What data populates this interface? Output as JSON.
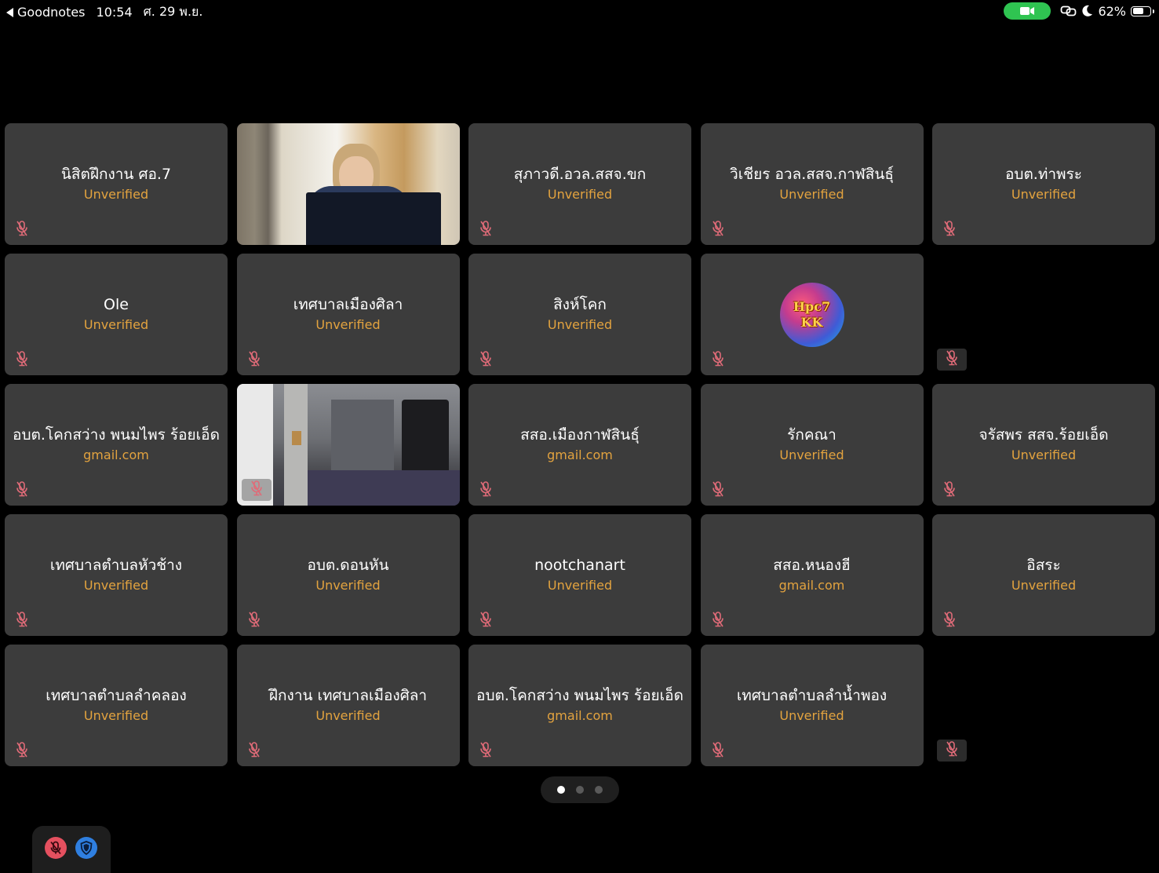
{
  "status_bar": {
    "back_app": "Goodnotes",
    "time": "10:54",
    "date": "ศ. 29 พ.ย.",
    "battery": "62%",
    "battery_level": 0.62
  },
  "tiles": [
    {
      "name": "นิสิตฝึกงาน ศอ.7",
      "sub": "Unverified"
    },
    {
      "video": true
    },
    {
      "name": "สุภาวดี.อวล.สสจ.ขก",
      "sub": "Unverified"
    },
    {
      "name": "วิเชียร อวล.สสจ.กาฬสินธุ์",
      "sub": "Unverified"
    },
    {
      "name": "อบต.ท่าพระ",
      "sub": "Unverified"
    },
    {
      "name": "Ole",
      "sub": "Unverified"
    },
    {
      "name": "เทศบาลเมืองศิลา",
      "sub": "Unverified"
    },
    {
      "name": "สิงห์โคก",
      "sub": "Unverified"
    },
    {
      "avatar": true
    },
    {
      "empty": true
    },
    {
      "name": "อบต.โคกสว่าง พนมไพร ร้อยเอ็ด",
      "sub": "gmail.com"
    },
    {
      "video": true
    },
    {
      "name": "สสอ.เมืองกาฬสินธุ์",
      "sub": "gmail.com"
    },
    {
      "name": "รักคณา",
      "sub": "Unverified"
    },
    {
      "name": "จรัสพร สสจ.ร้อยเอ็ด",
      "sub": "Unverified"
    },
    {
      "name": "เทศบาลตำบลหัวช้าง",
      "sub": "Unverified"
    },
    {
      "name": "อบต.ดอนหัน",
      "sub": "Unverified"
    },
    {
      "name": "nootchanart",
      "sub": "Unverified"
    },
    {
      "name": "สสอ.หนองฮี",
      "sub": "gmail.com"
    },
    {
      "name": "อิสระ",
      "sub": "Unverified"
    },
    {
      "name": "เทศบาลตำบลลำคลอง",
      "sub": "Unverified"
    },
    {
      "name": "ฝึกงาน เทศบาลเมืองศิลา",
      "sub": "Unverified"
    },
    {
      "name": "อบต.โคกสว่าง พนมไพร ร้อยเอ็ด",
      "sub": "gmail.com"
    },
    {
      "name": "เทศบาลตำบลลำน้ำพอง",
      "sub": "Unverified"
    },
    {
      "empty": true
    }
  ],
  "avatar_text": {
    "line1": "Hpc7",
    "line2": "KK"
  },
  "pager": {
    "pages": 3,
    "active": 0
  },
  "colors": {
    "tile_bg": "#3c3c3c",
    "sub_text": "#e3a33f",
    "muted_mic": "#e06b78",
    "video_pill": "#2fc451",
    "mute_button": "#e5505f",
    "shield_button": "#2f7fe0"
  }
}
